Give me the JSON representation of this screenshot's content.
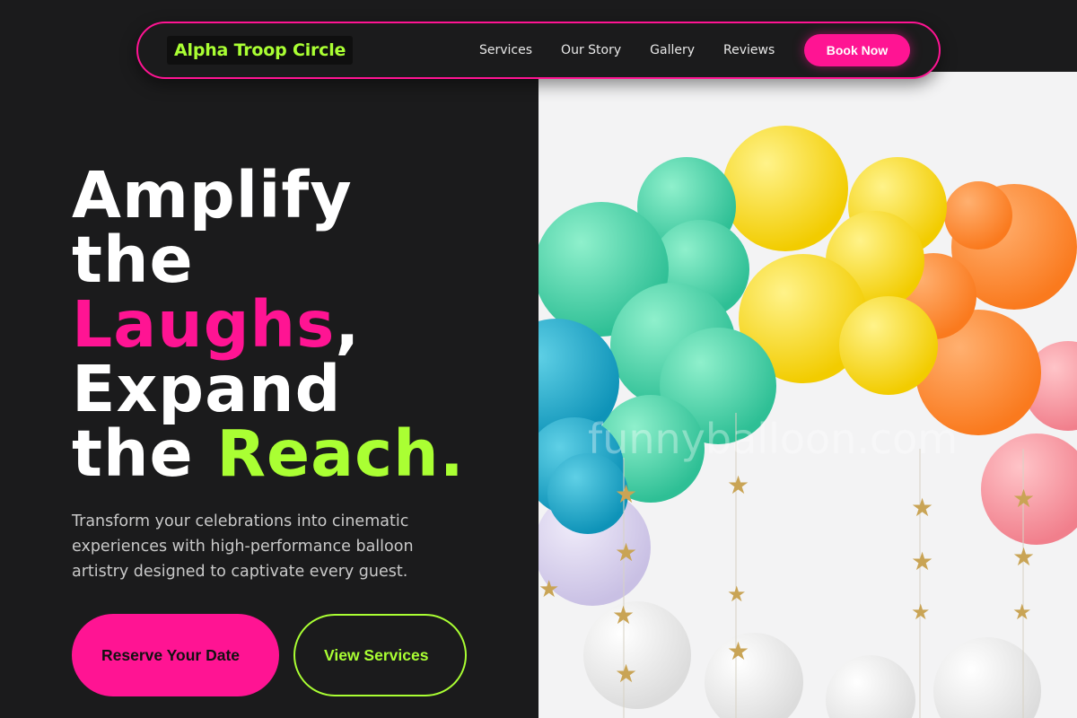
{
  "nav": {
    "brand": "Alpha Troop Circle",
    "links": [
      "Services",
      "Our Story",
      "Gallery",
      "Reviews"
    ],
    "cta": "Book Now"
  },
  "hero": {
    "line1": "Amplify",
    "line2": "the",
    "line3_accent": "Laughs",
    "line3_rest": ",",
    "line4": "Expand",
    "line5_pre": "the ",
    "line5_accent": "Reach."
  },
  "description": "Transform your celebrations into cinematic experiences with high-performance balloon artistry designed to captivate every guest.",
  "buttons": {
    "primary": "Reserve Your Date",
    "secondary": "View Services"
  },
  "image": {
    "watermark": "funnyballoon.com"
  },
  "colors": {
    "background": "#1b1b1c",
    "pink": "#ff1493",
    "green": "#aaff33"
  }
}
